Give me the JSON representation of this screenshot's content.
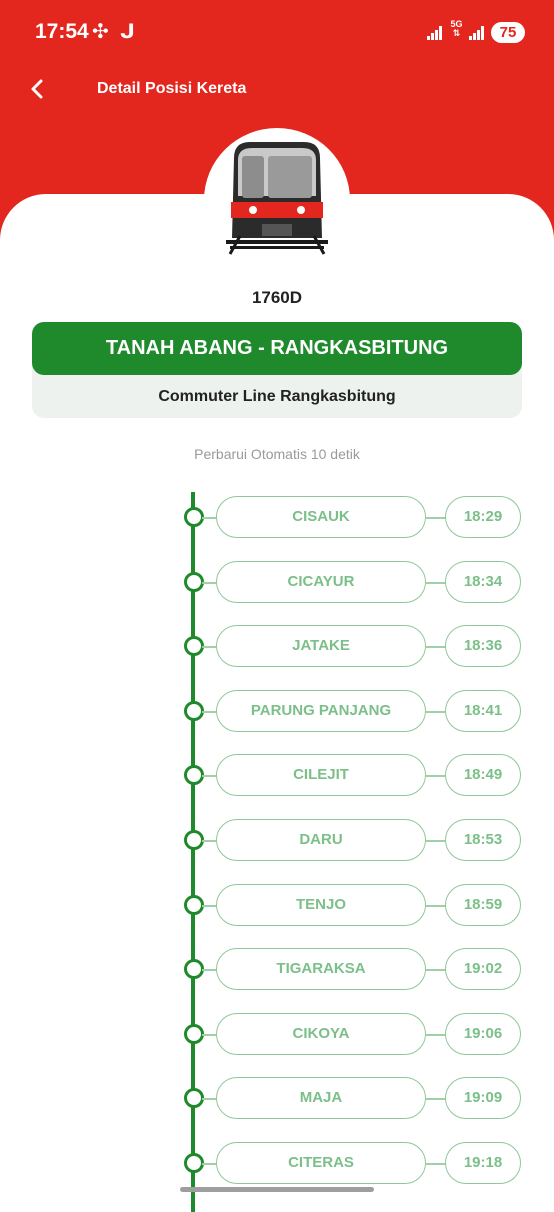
{
  "status_bar": {
    "time": "17:54",
    "fan_icon": "fan-icon",
    "j_icon": "ᒍ",
    "network": "5G",
    "battery": "75"
  },
  "header": {
    "title": "Detail Posisi Kereta"
  },
  "train": {
    "number": "1760D",
    "route": "TANAH ABANG - RANGKASBITUNG",
    "line_name": "Commuter Line Rangkasbitung"
  },
  "auto_refresh": "Perbarui Otomatis 10 detik",
  "stops": [
    {
      "station": "CISAUK",
      "time": "18:29"
    },
    {
      "station": "CICAYUR",
      "time": "18:34"
    },
    {
      "station": "JATAKE",
      "time": "18:36"
    },
    {
      "station": "PARUNG PANJANG",
      "time": "18:41"
    },
    {
      "station": "CILEJIT",
      "time": "18:49"
    },
    {
      "station": "DARU",
      "time": "18:53"
    },
    {
      "station": "TENJO",
      "time": "18:59"
    },
    {
      "station": "TIGARAKSA",
      "time": "19:02"
    },
    {
      "station": "CIKOYA",
      "time": "19:06"
    },
    {
      "station": "MAJA",
      "time": "19:09"
    },
    {
      "station": "CITERAS",
      "time": "19:18"
    }
  ],
  "colors": {
    "header_red": "#e3261e",
    "route_green": "#1f8a2c",
    "stop_text_green": "#7bbf89"
  }
}
